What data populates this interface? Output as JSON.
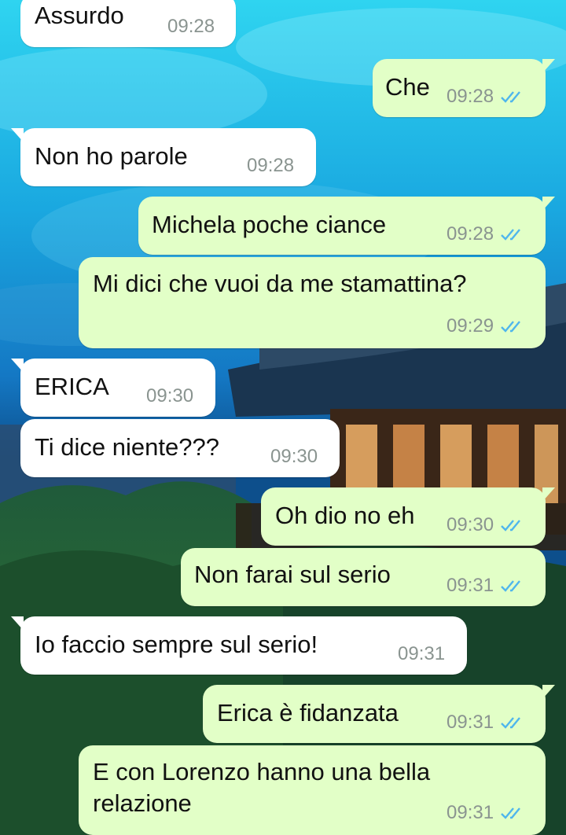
{
  "messages": [
    {
      "direction": "in",
      "text": "Assurdo",
      "time": "09:28"
    },
    {
      "direction": "out",
      "text": "Che",
      "time": "09:28"
    },
    {
      "direction": "in",
      "text": "Non ho parole",
      "time": "09:28"
    },
    {
      "direction": "out",
      "text": "Michela poche ciance",
      "time": "09:28"
    },
    {
      "direction": "out",
      "text": "Mi dici che vuoi da me stamattina?",
      "time": "09:29"
    },
    {
      "direction": "in",
      "text": "ERICA",
      "time": "09:30"
    },
    {
      "direction": "in",
      "text": "Ti dice niente???",
      "time": "09:30"
    },
    {
      "direction": "out",
      "text": "Oh dio no eh",
      "time": "09:30"
    },
    {
      "direction": "out",
      "text": "Non farai sul serio",
      "time": "09:31"
    },
    {
      "direction": "in",
      "text": "Io faccio sempre sul serio!",
      "time": "09:31"
    },
    {
      "direction": "out",
      "text": "Erica è fidanzata",
      "time": "09:31"
    },
    {
      "direction": "out",
      "text": "E con Lorenzo hanno una bella relazione",
      "time": "09:31"
    }
  ],
  "colors": {
    "incoming_bubble": "#ffffff",
    "outgoing_bubble": "#e2ffc7",
    "read_ticks": "#4fb6ec",
    "timestamp": "#8a9490"
  },
  "icons": {
    "read_receipt": "double-check-icon"
  }
}
